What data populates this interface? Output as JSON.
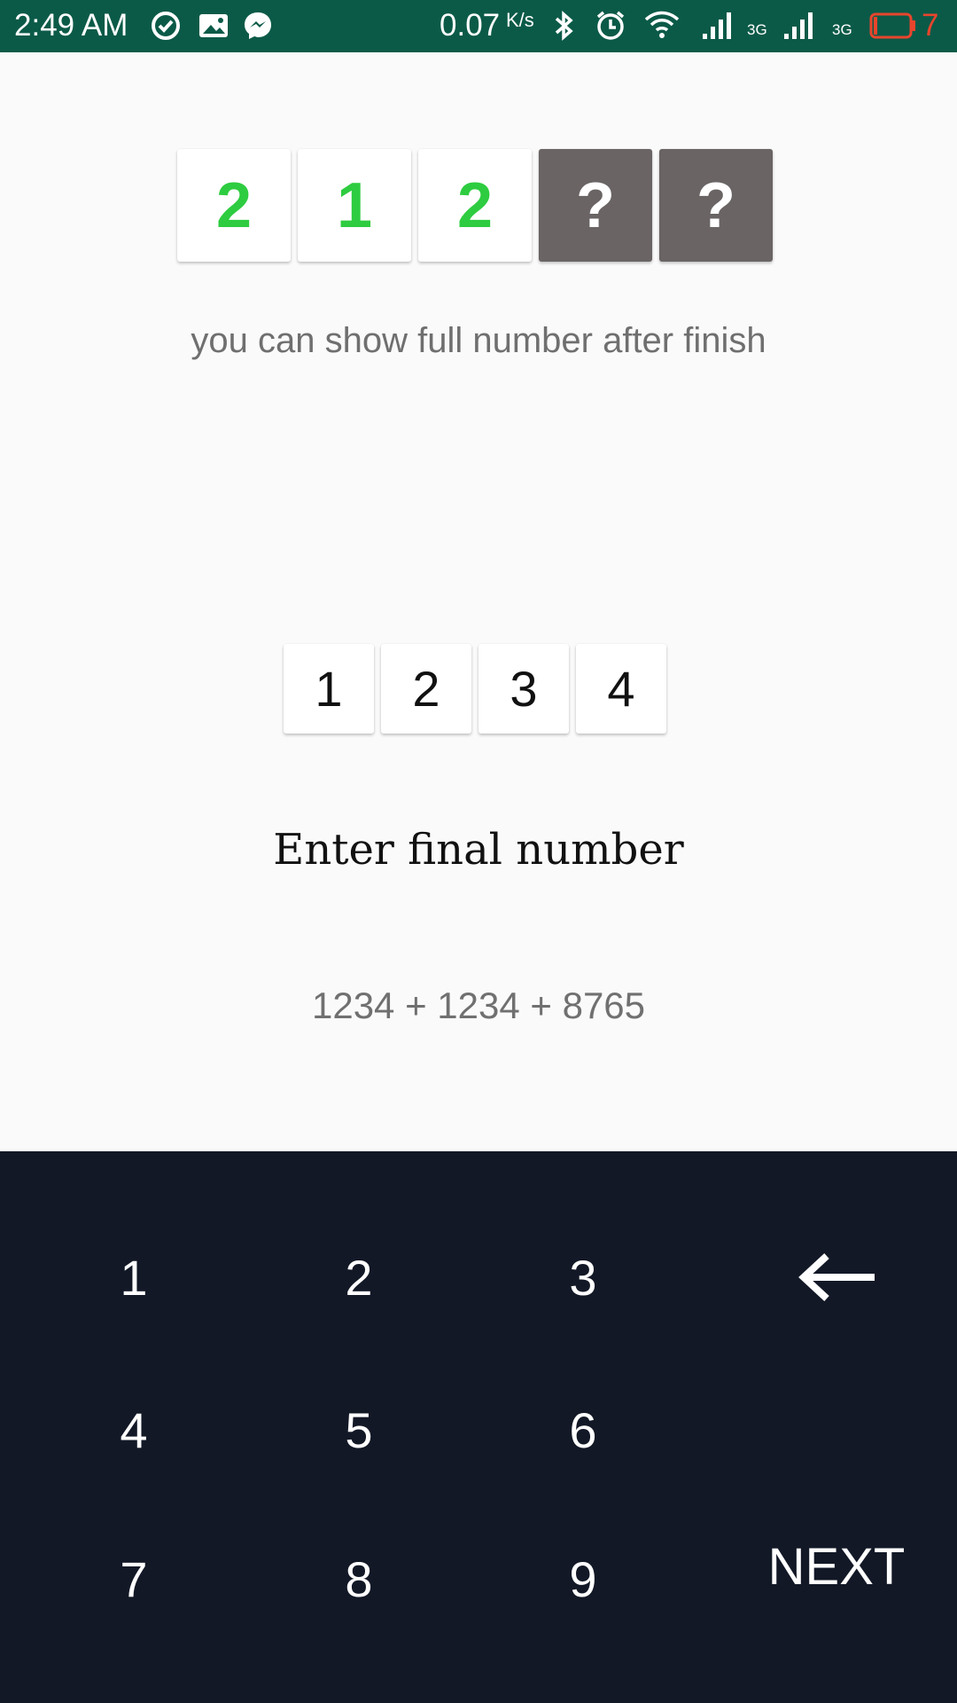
{
  "status_bar": {
    "time": "2:49 AM",
    "speed_value": "0.07",
    "speed_unit": "K/s",
    "network_1": "3G",
    "network_2": "3G",
    "battery_level": "7",
    "icons": [
      "check-circle-icon",
      "photo-icon",
      "messenger-icon",
      "bluetooth-icon",
      "alarm-icon",
      "wifi-icon",
      "signal-icon",
      "signal-icon",
      "battery-icon"
    ]
  },
  "top_digits": [
    "2",
    "1",
    "2",
    "?",
    "?"
  ],
  "hint": "you can show full number after finish",
  "entered_digits": [
    "1",
    "2",
    "3",
    "4"
  ],
  "prompt": "Enter final number",
  "expression": "1234 + 1234 + 8765",
  "keypad": {
    "keys": [
      "1",
      "2",
      "3",
      "4",
      "5",
      "6",
      "7",
      "8",
      "9"
    ],
    "backspace_icon": "backspace-arrow-icon",
    "next_label": "NEXT"
  },
  "colors": {
    "status_bar": "#0b5a48",
    "revealed_digit": "#2ecc40",
    "hidden_card": "#6a6464",
    "keypad_bg": "#121826",
    "battery_low": "#e8452c"
  }
}
